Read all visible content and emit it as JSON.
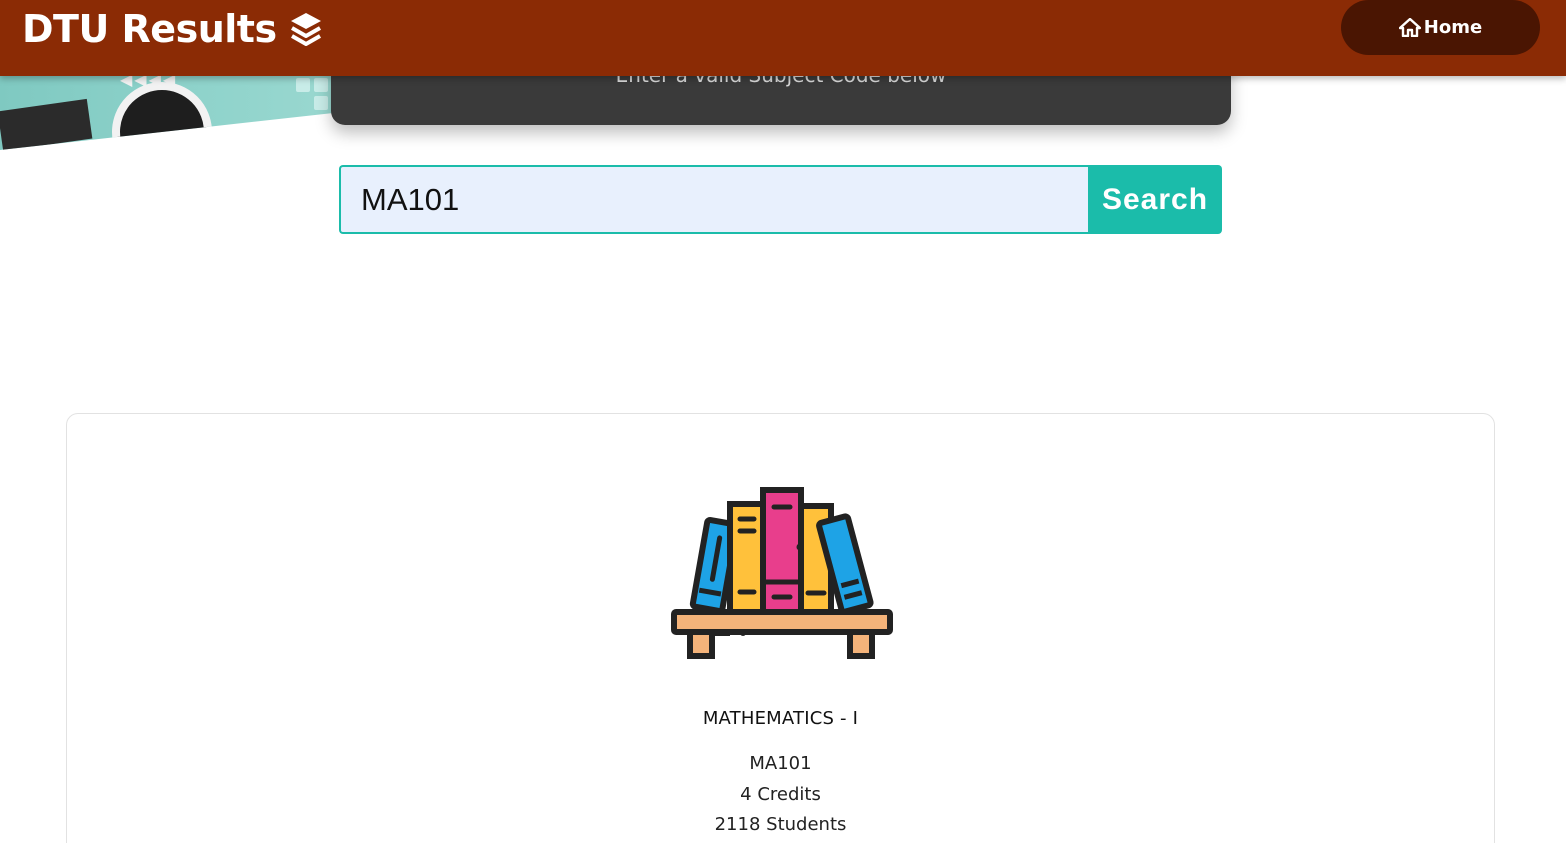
{
  "navbar": {
    "brand": "DTU Results",
    "brand_icon": "layers-icon",
    "home_label": "Home",
    "home_icon": "home-icon",
    "background_color": "#8b2b05",
    "home_button_color": "#4a1502"
  },
  "notice": {
    "text": "Enter a valid Subject Code below"
  },
  "search": {
    "value": "MA101",
    "button_label": "Search",
    "accent_color": "#1bbcaa",
    "input_background": "#e8f0fd"
  },
  "result": {
    "illustration": "bookshelf-icon",
    "subject_name": "MATHEMATICS - I",
    "subject_code": "MA101",
    "credits": "4 Credits",
    "students": "2118 Students"
  }
}
